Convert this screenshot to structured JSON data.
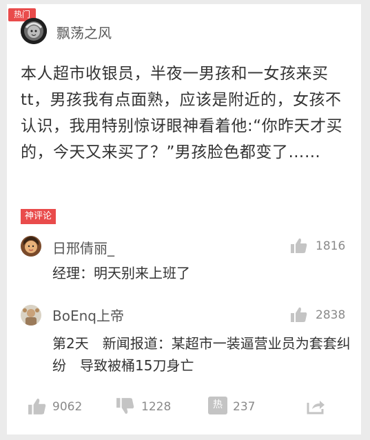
{
  "badge": {
    "hot": "热门"
  },
  "post": {
    "author": "飘荡之风",
    "text": "本人超市收银员，半夜一男孩和一女孩来买tt，男孩我有点面熟，应该是附近的，女孩不认识，我用特别惊讶眼神看着他:“你昨天才买的，今天又来买了？”男孩脸色都变了……"
  },
  "god_comments": {
    "label": "神评论",
    "items": [
      {
        "user": "日邢倩丽_",
        "likes": "1816",
        "text": "经理：明天别来上班了"
      },
      {
        "user": "BoEnq上帝",
        "likes": "2838",
        "text": "第2天　新闻报道：某超市一装逼营业员为套套纠纷　导致被桶15刀身亡"
      }
    ]
  },
  "actions": {
    "like_count": "9062",
    "dislike_count": "1228",
    "comment_count": "237",
    "comment_icon_text": "热"
  },
  "colors": {
    "accent": "#e94b4b",
    "icon_gray": "#c4c4c4"
  }
}
